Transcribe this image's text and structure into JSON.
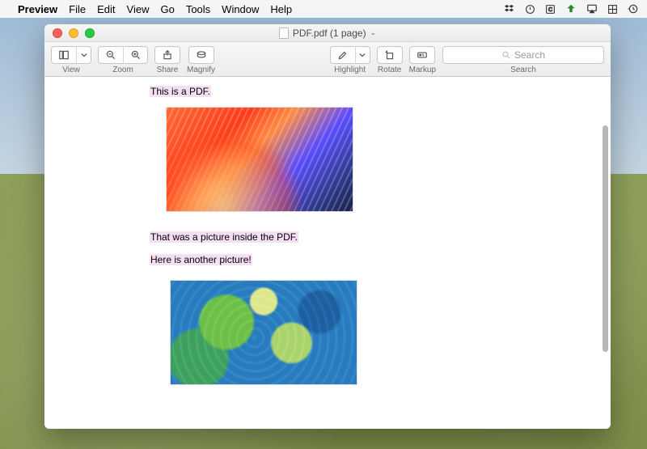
{
  "menubar": {
    "app": "Preview",
    "items": [
      "File",
      "Edit",
      "View",
      "Go",
      "Tools",
      "Window",
      "Help"
    ]
  },
  "window": {
    "title": "PDF.pdf (1 page)"
  },
  "toolbar": {
    "view_label": "View",
    "zoom_label": "Zoom",
    "share_label": "Share",
    "magnify_label": "Magnify",
    "highlight_label": "Highlight",
    "rotate_label": "Rotate",
    "markup_label": "Markup",
    "search_label": "Search",
    "search_placeholder": "Search"
  },
  "document": {
    "line1": "This is a PDF.",
    "line2": "That was a picture inside the PDF.",
    "line3": "Here is another picture!"
  }
}
